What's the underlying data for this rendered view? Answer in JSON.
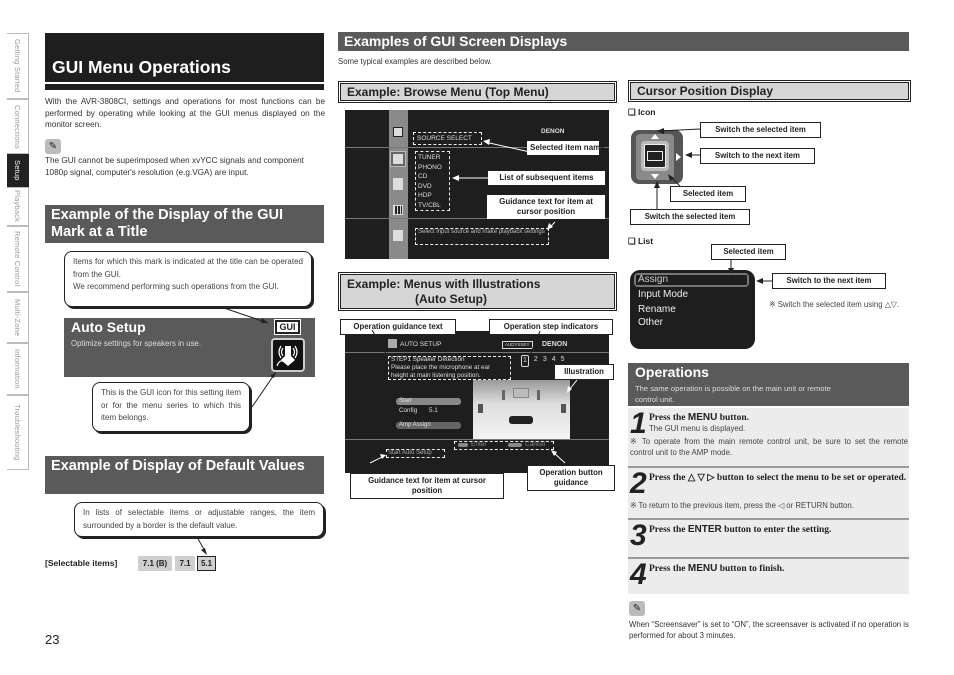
{
  "side_tabs": [
    {
      "label": "Getting Started",
      "active": false
    },
    {
      "label": "Connections",
      "active": false
    },
    {
      "label": "Setup",
      "active": true
    },
    {
      "label": "Playback",
      "active": false
    },
    {
      "label": "Remote Control",
      "active": false
    },
    {
      "label": "Multi-Zone",
      "active": false
    },
    {
      "label": "Information",
      "active": false
    },
    {
      "label": "Troubleshooting",
      "active": false
    }
  ],
  "left": {
    "title": "GUI Menu Operations",
    "intro": "With the AVR-3808CI, settings and operations for most functions can be performed by operating while looking at the GUI menus displayed on the monitor screen.",
    "note_icon": "pencil-icon",
    "note": "The GUI cannot be superimposed when xvYCC signals and component 1080p signal, computer's resolution (e.g.VGA) are input.",
    "gui_mark_section": {
      "heading": "Example of the Display of the GUI Mark at a Title",
      "callout_top": "Items for which this mark is indicated at the title can be operated from the GUI.\nWe recommend performing such operations from the GUI.",
      "example_title": "Auto Setup",
      "example_subtitle": "Optimize settings for speakers in use.",
      "gui_badge": "GUI",
      "callout_bottom": "This is the GUI icon for this setting item or for the menu series to which this item belongs."
    },
    "default_section": {
      "heading": "Example of Display of Default Values",
      "callout": "In lists of selectable items or adjustable ranges, the item surrounded by a border is the default value.",
      "selectable_label": "[Selectable items]",
      "items": [
        {
          "label": "7.1 (B)",
          "default": false
        },
        {
          "label": "7.1",
          "default": false
        },
        {
          "label": "5.1",
          "default": true
        }
      ]
    },
    "page_number": "23"
  },
  "middle": {
    "heading": "Examples of GUI Screen Displays",
    "subtitle": "Some typical examples are described below.",
    "browse": {
      "heading": "Example:  Browse Menu (Top Menu)",
      "brand": "DENON",
      "selected_name": "SOURCE SELECT",
      "items": [
        "TUNER",
        "PHONO",
        "CD",
        "DVD",
        "HDP",
        "TV/CBL"
      ],
      "guidance": "Select input source and make playback settings",
      "labels": {
        "selected": "Selected item name",
        "list": "List of subsequent items",
        "guidance": "Guidance text for item at cursor position"
      }
    },
    "auto_setup": {
      "heading_line1": "Example:  Menus with Illustrations",
      "heading_line2": "(Auto Setup)",
      "screen_title": "AUTO SETUP",
      "audyssey": "AUDYSSEY",
      "brand": "DENON",
      "guide_lines": [
        "STEP1 Speaker Detection",
        "Please place the microphone at ear",
        "height at main listening position."
      ],
      "steps": [
        "1",
        "2",
        "3",
        "4",
        "5"
      ],
      "menu": [
        {
          "label": "Start",
          "value": ""
        },
        {
          "label": "Config",
          "value": "5.1"
        },
        {
          "label": "Amp Assign",
          "value": ""
        }
      ],
      "enter_label": "Enter",
      "cancel_label": "Cancel",
      "bottom_guidance": "Start Auto Setup",
      "labels": {
        "op_guidance": "Operation guidance text",
        "step_ind": "Operation step indicators",
        "illustration": "Illustration",
        "cursor_guidance": "Guidance text for item at cursor position",
        "button_guidance": "Operation button guidance"
      }
    }
  },
  "right": {
    "cursor": {
      "heading": "Cursor Position Display",
      "icon_heading": "❑ Icon",
      "icon_labels": {
        "up": "Switch the selected item",
        "next": "Switch to the next item",
        "selected": "Selected item",
        "down": "Switch the selected item"
      },
      "list_heading": "❑ List",
      "list_items": [
        "Assign",
        "Input Mode",
        "Rename",
        "Other"
      ],
      "list_labels": {
        "selected": "Selected item",
        "next": "Switch to the next item"
      },
      "list_note": "※ Switch the selected item using △▽."
    },
    "operations": {
      "heading": "Operations",
      "subtitle": "The same operation is possible on the main unit or remote control unit.",
      "steps": [
        {
          "num": "1",
          "pre": "Press the ",
          "kw": "MENU",
          "post": " button.",
          "sub": "The GUI menu is displayed.",
          "note": "※ To operate from the main remote control unit, be sure to set the remote control unit to the AMP mode."
        },
        {
          "num": "2",
          "pre": "Press the △  ▽  ▷ button to select the menu to be set or operated.",
          "kw": "",
          "post": "",
          "sub": "",
          "note": "※ To return to the previous item, press the ◁ or RETURN button."
        },
        {
          "num": "3",
          "pre": "Press the ",
          "kw": "ENTER",
          "post": " button to enter the setting.",
          "sub": "",
          "note": ""
        },
        {
          "num": "4",
          "pre": "Press the ",
          "kw": "MENU",
          "post": " button to finish.",
          "sub": "",
          "note": ""
        }
      ],
      "note_icon": "pencil-icon",
      "note": "When “Screensaver” is set to “ON”, the screensaver is activated if no operation is performed for about 3 minutes."
    }
  }
}
